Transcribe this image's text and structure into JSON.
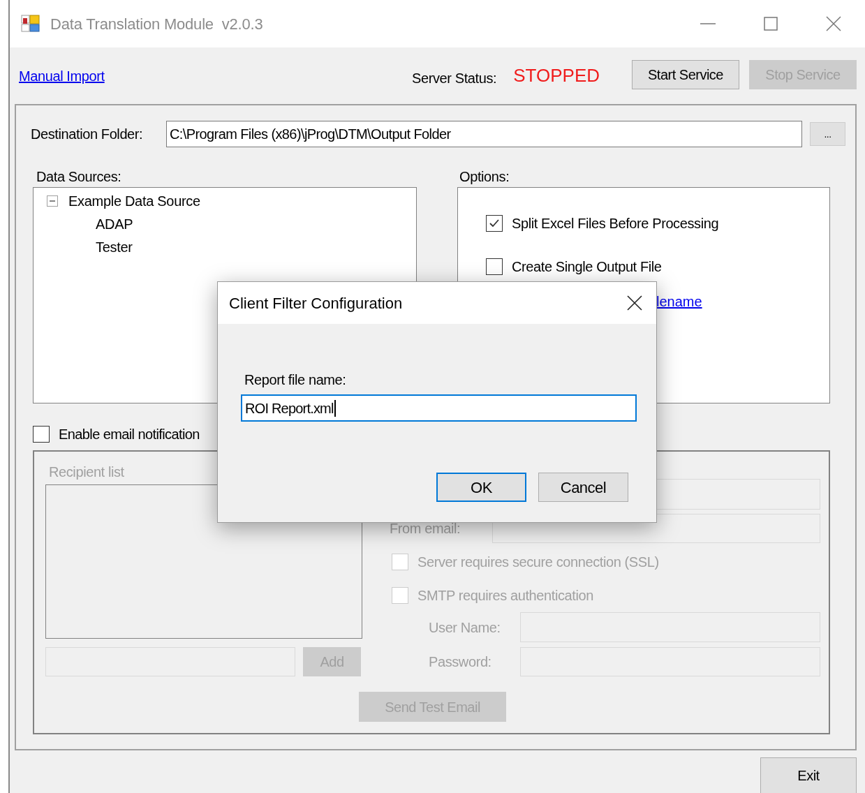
{
  "window": {
    "title": "Data Translation Module  v2.0.3"
  },
  "toolbar": {
    "manual_import_link": "Manual Import",
    "server_status_label": "Server Status:",
    "server_status": "STOPPED",
    "buttons": [
      {
        "label": "Start Service",
        "disabled": false
      },
      {
        "label": "Stop Service",
        "disabled": true
      }
    ]
  },
  "destination": {
    "label": "Destination Folder:",
    "value": "C:\\Program Files (x86)\\jProg\\DTM\\Output Folder",
    "browse_button": "..."
  },
  "data_sources": {
    "label": "Data Sources:",
    "tree": [
      {
        "label": "Example Data Source",
        "expanded": true,
        "children": [
          {
            "label": "ADAP"
          },
          {
            "label": "Tester"
          }
        ]
      }
    ]
  },
  "options": {
    "label": "Options:",
    "items": [
      {
        "label": "Split Excel Files Before Processing",
        "checked": true
      },
      {
        "label": "Create Single Output File",
        "checked": false
      }
    ],
    "link": "lename"
  },
  "email": {
    "enable_label": "Enable email notification",
    "enabled": false,
    "recipient_list_label": "Recipient list",
    "add_button": "Add",
    "from_email_label": "From email:",
    "checkboxes": [
      {
        "label": "Server requires secure connection (SSL)",
        "checked": false
      },
      {
        "label": "SMTP requires authentication",
        "checked": false
      }
    ],
    "user_name_label": "User Name:",
    "password_label": "Password:",
    "send_test_button": "Send Test Email"
  },
  "exit_button": "Exit",
  "dialog": {
    "title": "Client Filter Configuration",
    "field_label": "Report file name:",
    "field_value": "ROI Report.xml",
    "buttons": [
      {
        "label": "OK",
        "focused": true
      },
      {
        "label": "Cancel",
        "focused": false
      }
    ]
  }
}
